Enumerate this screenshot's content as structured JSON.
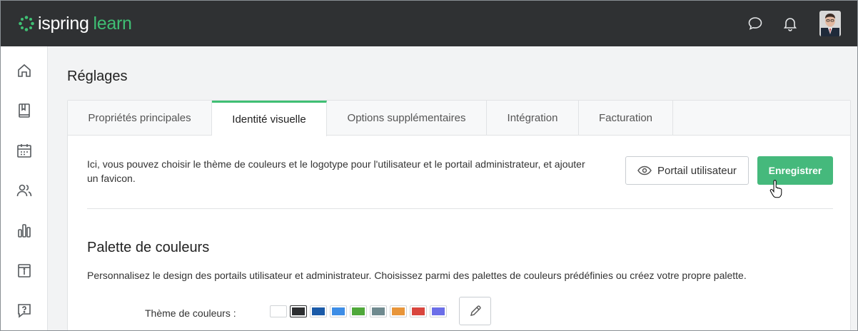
{
  "app": {
    "logo_word1": "ispring",
    "logo_word2": "learn",
    "brand_color": "#3fbf74"
  },
  "topbar": {
    "icons": [
      "chat-icon",
      "bell-icon"
    ],
    "avatar": "user-avatar"
  },
  "sidebar": {
    "items": [
      {
        "icon": "home-icon"
      },
      {
        "icon": "book-icon"
      },
      {
        "icon": "calendar-icon"
      },
      {
        "icon": "users-icon"
      },
      {
        "icon": "bar-chart-icon"
      },
      {
        "icon": "info-icon"
      },
      {
        "icon": "help-icon"
      }
    ]
  },
  "page": {
    "title": "Réglages"
  },
  "tabs": [
    {
      "label": "Propriétés principales",
      "active": false
    },
    {
      "label": "Identité visuelle",
      "active": true
    },
    {
      "label": "Options supplémentaires",
      "active": false
    },
    {
      "label": "Intégration",
      "active": false
    },
    {
      "label": "Facturation",
      "active": false
    }
  ],
  "intro": {
    "text": "Ici, vous pouvez choisir le thème de couleurs et le logotype pour l'utilisateur et le portail administrateur, et ajouter un favicon."
  },
  "actions": {
    "portal_label": "Portail utilisateur",
    "save_label": "Enregistrer"
  },
  "palette": {
    "title": "Palette de couleurs",
    "description": "Personnalisez le design des portails utilisateur et administrateur. Choisissez parmi des palettes de couleurs prédéfinies ou créez votre propre palette.",
    "theme_label": "Thème de couleurs :",
    "swatches": [
      "#ffffff",
      "#2d2f31",
      "#1a5aa8",
      "#3d8de6",
      "#4fa83a",
      "#6f8a8f",
      "#e8953a",
      "#d9463e",
      "#6b6ee8"
    ],
    "selected_index": 1
  }
}
